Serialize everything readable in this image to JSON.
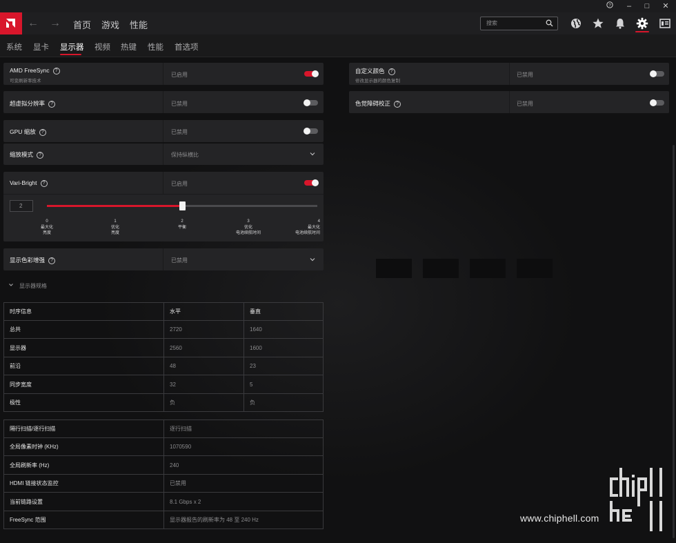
{
  "window": {
    "help_icon": "question-circle-icon",
    "minimize": "–",
    "maximize": "□",
    "close": "✕"
  },
  "topnav": {
    "home": "首页",
    "gaming": "游戏",
    "performance": "性能",
    "search_placeholder": "搜索"
  },
  "subtabs": [
    "系统",
    "显卡",
    "显示器",
    "视频",
    "热键",
    "性能",
    "首选项"
  ],
  "left": {
    "freesync": {
      "label": "AMD FreeSync",
      "sub": "可变刷新率技术",
      "value": "已启用"
    },
    "vsr": {
      "label": "超虚拟分辨率",
      "value": "已禁用"
    },
    "gpu_scaling": {
      "label": "GPU 缩放",
      "value": "已禁用"
    },
    "scaling_mode": {
      "label": "缩放模式",
      "value": "保持纵横比"
    },
    "vari_bright": {
      "label": "Vari-Bright",
      "value": "已启用"
    },
    "slider": {
      "value": "2",
      "level": 2,
      "ticks": [
        {
          "num": "0",
          "l1": "最大化",
          "l2": "亮度"
        },
        {
          "num": "1",
          "l1": "优化",
          "l2": "亮度"
        },
        {
          "num": "2",
          "l1": "平衡",
          "l2": ""
        },
        {
          "num": "3",
          "l1": "优化",
          "l2": "电池续航时间"
        },
        {
          "num": "4",
          "l1": "最大化",
          "l2": "电池续航时间"
        }
      ]
    },
    "color_enhance": {
      "label": "显示色彩增强",
      "value": "已禁用"
    },
    "specs_toggle": "显示器规格"
  },
  "right": {
    "custom_color": {
      "label": "自定义颜色",
      "sub": "修改显示器的颜色复制",
      "value": "已禁用"
    },
    "color_blind": {
      "label": "色觉障碍校正",
      "value": "已禁用"
    }
  },
  "timing_table": {
    "headers": [
      "时序信息",
      "水平",
      "垂直"
    ],
    "rows": [
      [
        "总共",
        "2720",
        "1640"
      ],
      [
        "显示器",
        "2560",
        "1600"
      ],
      [
        "前沿",
        "48",
        "23"
      ],
      [
        "同步宽度",
        "32",
        "5"
      ],
      [
        "极性",
        "负",
        "负"
      ]
    ]
  },
  "info_table": {
    "rows": [
      [
        "隔行扫描/逐行扫描",
        "逐行扫描"
      ],
      [
        "全局像素时钟 (KHz)",
        "1070590"
      ],
      [
        "全局刷新率 (Hz)",
        "240"
      ],
      [
        "HDMI 链接状态监控",
        "已禁用"
      ],
      [
        "当前链路设置",
        "8.1 Gbps x 2"
      ],
      [
        "FreeSync 范围",
        "显示器报告的刷新率为 48 至 240 Hz"
      ]
    ]
  },
  "watermark": {
    "text": "www.chiphell.com"
  },
  "colors": {
    "accent": "#d8162b",
    "card": "#242426",
    "background": "#111112"
  }
}
